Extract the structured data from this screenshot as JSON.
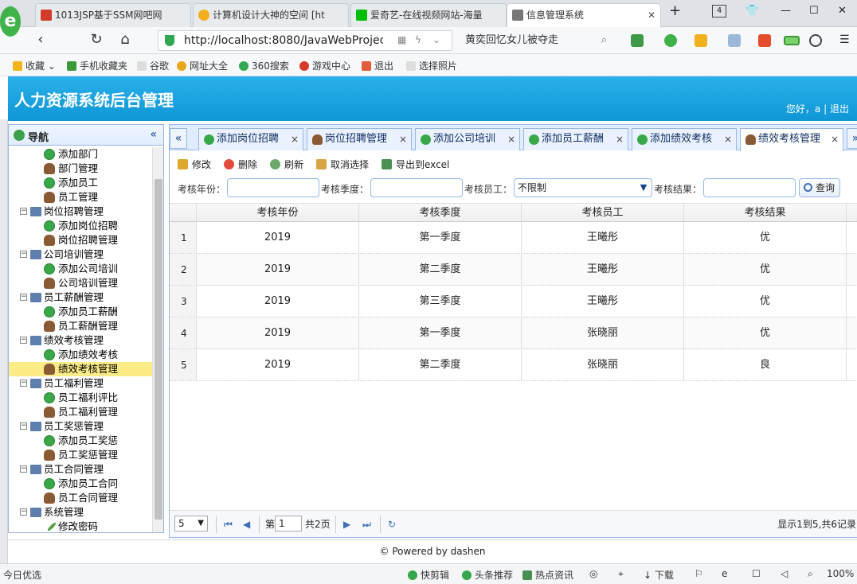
{
  "browser": {
    "logo": "e",
    "tabs": [
      {
        "label": "1013JSP基于SSM网吧网",
        "color": "#d23b2a"
      },
      {
        "label": "计算机设计大神的空间 [ht",
        "color": "#f2b01e"
      },
      {
        "label": "爱奇艺-在线视频网站-海量",
        "color": "#00be06"
      },
      {
        "label": "信息管理系统",
        "color": "#777777"
      }
    ],
    "new_tab": "+",
    "tab_count": "4",
    "url": "http://localhost:8080/JavaWebProject",
    "search_text": "黄奕回忆女儿被夺走",
    "bookmarks": [
      "收藏",
      "手机收藏夹",
      "谷歌",
      "网址大全",
      "360搜索",
      "游戏中心",
      "退出",
      "选择照片"
    ]
  },
  "app": {
    "title": "人力资源系统后台管理",
    "greeting": "您好，a",
    "separator": "|",
    "logout": "退出",
    "footer": "© Powered by dashen"
  },
  "sidebar": {
    "title": "导航",
    "collapse": "«",
    "items": [
      {
        "type": "leaf",
        "icon": "add",
        "label": "添加部门"
      },
      {
        "type": "leaf",
        "icon": "mgr",
        "label": "部门管理"
      },
      {
        "type": "leaf",
        "icon": "add",
        "label": "添加员工"
      },
      {
        "type": "leaf",
        "icon": "mgr",
        "label": "员工管理"
      },
      {
        "type": "group",
        "label": "岗位招聘管理"
      },
      {
        "type": "leaf",
        "icon": "add",
        "label": "添加岗位招聘"
      },
      {
        "type": "leaf",
        "icon": "mgr",
        "label": "岗位招聘管理"
      },
      {
        "type": "group",
        "label": "公司培训管理"
      },
      {
        "type": "leaf",
        "icon": "add",
        "label": "添加公司培训"
      },
      {
        "type": "leaf",
        "icon": "mgr",
        "label": "公司培训管理"
      },
      {
        "type": "group",
        "label": "员工薪酬管理"
      },
      {
        "type": "leaf",
        "icon": "add",
        "label": "添加员工薪酬"
      },
      {
        "type": "leaf",
        "icon": "mgr",
        "label": "员工薪酬管理"
      },
      {
        "type": "group",
        "label": "绩效考核管理"
      },
      {
        "type": "leaf",
        "icon": "add",
        "label": "添加绩效考核"
      },
      {
        "type": "leaf",
        "icon": "mgr",
        "label": "绩效考核管理",
        "selected": true
      },
      {
        "type": "group",
        "label": "员工福利管理"
      },
      {
        "type": "leaf",
        "icon": "add",
        "label": "员工福利评比"
      },
      {
        "type": "leaf",
        "icon": "mgr",
        "label": "员工福利管理"
      },
      {
        "type": "group",
        "label": "员工奖惩管理"
      },
      {
        "type": "leaf",
        "icon": "add",
        "label": "添加员工奖惩"
      },
      {
        "type": "leaf",
        "icon": "mgr",
        "label": "员工奖惩管理"
      },
      {
        "type": "group",
        "label": "员工合同管理"
      },
      {
        "type": "leaf",
        "icon": "add",
        "label": "添加员工合同"
      },
      {
        "type": "leaf",
        "icon": "mgr",
        "label": "员工合同管理"
      },
      {
        "type": "group",
        "label": "系统管理"
      },
      {
        "type": "leaf",
        "icon": "pen",
        "label": "修改密码"
      }
    ]
  },
  "main": {
    "tabs": [
      {
        "label": "添加岗位招聘",
        "icon": "add"
      },
      {
        "label": "岗位招聘管理",
        "icon": "mgr"
      },
      {
        "label": "添加公司培训",
        "icon": "add"
      },
      {
        "label": "添加员工薪酬",
        "icon": "add"
      },
      {
        "label": "添加绩效考核",
        "icon": "add"
      },
      {
        "label": "绩效考核管理",
        "icon": "mgr",
        "active": true
      }
    ],
    "toolbar": {
      "edit": "修改",
      "delete": "删除",
      "refresh": "刷新",
      "cancel_select": "取消选择",
      "export": "导出到excel"
    },
    "filter": {
      "year_label": "考核年份：",
      "year_value": "",
      "season_label": "考核季度：",
      "season_value": "",
      "employee_label": "考核员工：",
      "employee_value": "不限制",
      "result_label": "考核结果：",
      "result_value": "",
      "query": "查询"
    },
    "grid": {
      "columns": [
        "考核年份",
        "考核季度",
        "考核员工",
        "考核结果"
      ],
      "rows": [
        {
          "n": "1",
          "year": "2019",
          "season": "第一季度",
          "employee": "王曦彤",
          "result": "优"
        },
        {
          "n": "2",
          "year": "2019",
          "season": "第二季度",
          "employee": "王曦彤",
          "result": "优"
        },
        {
          "n": "3",
          "year": "2019",
          "season": "第三季度",
          "employee": "王曦彤",
          "result": "优"
        },
        {
          "n": "4",
          "year": "2019",
          "season": "第一季度",
          "employee": "张晓丽",
          "result": "优"
        },
        {
          "n": "5",
          "year": "2019",
          "season": "第二季度",
          "employee": "张晓丽",
          "result": "良"
        }
      ]
    },
    "pager": {
      "page_size": "5",
      "page_prefix": "第",
      "page_num": "1",
      "page_total": "共2页",
      "summary": "显示1到5,共6记录"
    }
  },
  "status": {
    "left": "今日优选",
    "items": [
      "快剪辑",
      "头条推荐",
      "热点资讯",
      "下载"
    ],
    "zoom": "100%"
  }
}
